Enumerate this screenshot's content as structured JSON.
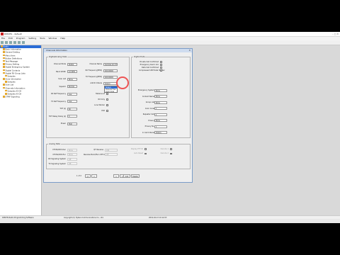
{
  "window": {
    "title": "DMCHS - default",
    "controls": "–  □  ✕"
  },
  "menu": [
    "File",
    "Edit",
    "Program",
    "Setting",
    "Tools",
    "Window",
    "Help"
  ],
  "tree": [
    {
      "label": "Radio",
      "indent": 0,
      "selected": true
    },
    {
      "label": "Basic Information",
      "indent": 1
    },
    {
      "label": "General Setting",
      "indent": 1
    },
    {
      "label": "Menu Item",
      "indent": 1
    },
    {
      "label": "Button Definitions",
      "indent": 1
    },
    {
      "label": "Text Message",
      "indent": 1
    },
    {
      "label": "Privacy Setting",
      "indent": 1
    },
    {
      "label": "Digital Emergency System",
      "indent": 1
    },
    {
      "label": "Digital Contacts",
      "indent": 1
    },
    {
      "label": "Digital RX Group Lists",
      "indent": 1
    },
    {
      "label": "Samples",
      "indent": 2
    },
    {
      "label": "Zone Information",
      "indent": 1
    },
    {
      "label": "Samples",
      "indent": 2
    },
    {
      "label": "Scan List",
      "indent": 1
    },
    {
      "label": "Channels Information",
      "indent": 1
    },
    {
      "label": "Samples All CH",
      "indent": 2
    },
    {
      "label": "Samples All CH",
      "indent": 2
    },
    {
      "label": "DTMF Signaling",
      "indent": 1
    }
  ],
  "dialog": {
    "title": "Channels Information",
    "close": "✕",
    "groups": {
      "analog_digital": "Digital/Analog Data",
      "digital": "Digital Data",
      "analog": "Analog Data"
    },
    "left_fields": [
      {
        "label": "Channel Mode",
        "value": "Digital"
      },
      {
        "label": "Band Width",
        "value": "12.5KHz"
      },
      {
        "label": "Scan List",
        "value": "None"
      },
      {
        "label": "Squelch",
        "value": "Normal"
      },
      {
        "label": "RX Ref Frequency",
        "value": "Low"
      },
      {
        "label": "TX Ref Frequency",
        "value": "Low"
      },
      {
        "label": "TOT [s]",
        "value": "60"
      },
      {
        "label": "TOT Rekey Delay [s]",
        "value": "0"
      },
      {
        "label": "Power",
        "value": "High"
      }
    ],
    "mid_fields": [
      {
        "label": "Channel Name",
        "value": "Samples All CH1"
      },
      {
        "label": "RX Frequency[MHz]",
        "value": "400.00000"
      },
      {
        "label": "TX Frequency[MHz]",
        "value": "400.00000"
      },
      {
        "label": "Admit Criteria",
        "value": "Always"
      }
    ],
    "popup_options": [
      "Always",
      "Channel Free",
      "Color Code"
    ],
    "mid_checks": [
      "Talkaround",
      "RX Only",
      "Lone Worker",
      "VOX"
    ],
    "digital_checks": [
      "Private Call Confirmed",
      "Emergency Alarm Ack",
      "Data Call Confirmed",
      "Compressed UDP Data Header"
    ],
    "digital_fields": [
      {
        "label": "Emergency System",
        "value": "None"
      },
      {
        "label": "Contact Name",
        "value": "None"
      },
      {
        "label": "Group List",
        "value": "None"
      },
      {
        "label": "Color Code",
        "value": "1"
      },
      {
        "label": "Repeater Slot",
        "value": "1"
      },
      {
        "label": "Privacy",
        "value": "None"
      },
      {
        "label": "Privacy No.",
        "value": "1"
      },
      {
        "label": "In Call Criteria",
        "value": "Always"
      }
    ],
    "analog_fields": [
      {
        "label": "CTCSS/DCS Dec",
        "value": "None"
      },
      {
        "label": "CTCSS/DCS Enc",
        "value": "None"
      },
      {
        "label": "RX Signaling System",
        "value": "Off"
      },
      {
        "label": "TX Signaling System",
        "value": "Off"
      }
    ],
    "analog_right": [
      {
        "label": "QT Reverse",
        "value": "180"
      },
      {
        "label": "Reverse Burst/Turn Off Code",
        "value": "Off"
      }
    ],
    "analog_checks": [
      "Display PTT ID",
      "Auto Reset",
      "Decode 1",
      "Decode 2"
    ],
    "pager": {
      "text": "1 of 2",
      "first": "|<",
      "prev": "<",
      "next": ">",
      "last": ">|",
      "add": "Add",
      "delete": "Delete"
    }
  },
  "status": {
    "left": "DMCHS Radio Programming Software",
    "center": "Copyright (C) Hytera Communications Co., Ltd.",
    "right": "2019-02-13 10:12:03"
  },
  "colors": {
    "accent": "#2b6cd6",
    "highlight_ring": "#e55555",
    "dialog_title": "#cfdcef"
  }
}
